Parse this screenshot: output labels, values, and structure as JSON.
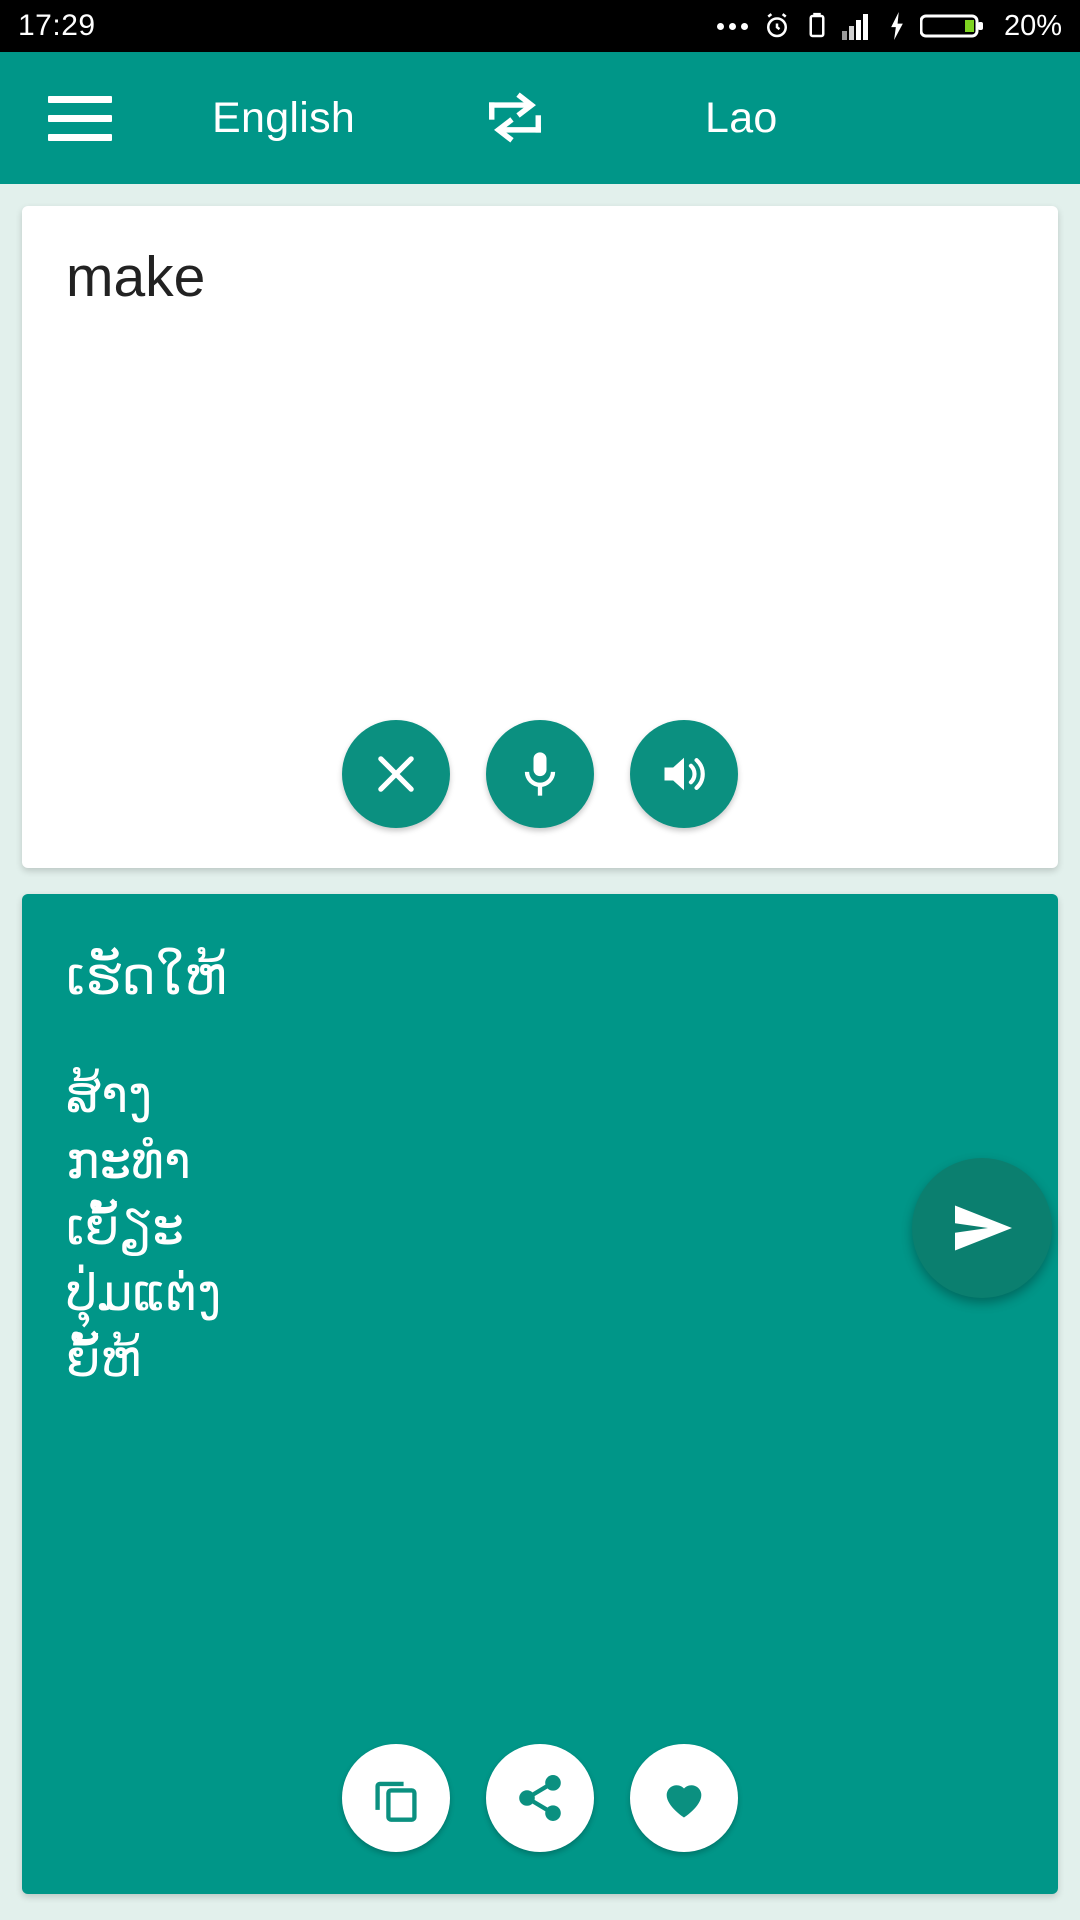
{
  "status_bar": {
    "time": "17:29",
    "battery_percent": "20%",
    "icons": [
      "more-dots-icon",
      "alarm-clock-icon",
      "vibrate-icon",
      "signal-bars-icon",
      "charging-bolt-icon",
      "battery-icon"
    ]
  },
  "toolbar": {
    "menu_icon": "hamburger-menu-icon",
    "source_language": "English",
    "swap_icon": "swap-languages-icon",
    "target_language": "Lao"
  },
  "input_card": {
    "text": "make",
    "placeholder": "",
    "actions": [
      {
        "name": "clear-button",
        "icon": "close-icon"
      },
      {
        "name": "voice-input-button",
        "icon": "microphone-icon"
      },
      {
        "name": "speak-source-button",
        "icon": "speaker-icon"
      }
    ]
  },
  "send_button": {
    "label": "",
    "icon": "send-icon"
  },
  "result_card": {
    "main_translation": "ເຮັດໃຫ້",
    "alternatives": [
      "ສ້າງ",
      "ກະທຳ",
      "ເຍັ້ຽະ",
      "ປຸ່ມແຕ່ງ",
      "ຍັ້ຫ້"
    ],
    "actions": [
      {
        "name": "copy-button",
        "icon": "copy-icon"
      },
      {
        "name": "share-button",
        "icon": "share-icon"
      },
      {
        "name": "favorite-button",
        "icon": "heart-icon"
      }
    ]
  },
  "colors": {
    "primary_teal": "#009688",
    "dark_teal": "#0b7f6f",
    "page_background": "#e2f0ec",
    "status_bar": "#000000",
    "battery_green": "#7ed321"
  }
}
